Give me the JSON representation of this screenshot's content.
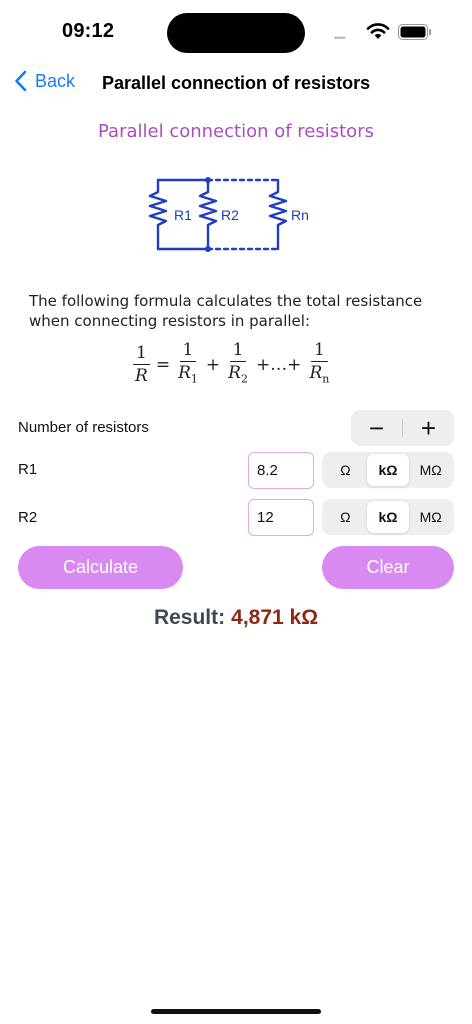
{
  "status_bar": {
    "time": "09:12",
    "signal": "•••••"
  },
  "nav": {
    "back_label": "Back",
    "title": "Parallel connection of resistors"
  },
  "heading": "Parallel connection of resistors",
  "circuit_labels": {
    "r1": "R1",
    "r2": "R2",
    "rn": "Rn"
  },
  "description": "The following formula calculates the total resistance when connecting resistors in parallel:",
  "formula": {
    "one": "1",
    "lhs_den": "R",
    "eq": "=",
    "plus": "+",
    "ellipsis": "+…+",
    "r_symbol": "R",
    "sub1": "1",
    "sub2": "2",
    "subn": "n"
  },
  "count_row": {
    "label": "Number of resistors",
    "minus": "−",
    "plus": "+"
  },
  "resistors": [
    {
      "label": "R1",
      "value": "8.2",
      "units": [
        "Ω",
        "kΩ",
        "MΩ"
      ],
      "selected_unit": "kΩ"
    },
    {
      "label": "R2",
      "value": "12",
      "units": [
        "Ω",
        "kΩ",
        "MΩ"
      ],
      "selected_unit": "kΩ"
    }
  ],
  "buttons": {
    "calculate": "Calculate",
    "clear": "Clear"
  },
  "result": {
    "label": "Result:",
    "value": "4,871 kΩ"
  },
  "colors": {
    "accent": "#1a7cf0",
    "heading": "#a94fbd",
    "button": "#d98af0",
    "result_value": "#8a2a14",
    "circuit": "#1f3fbf"
  }
}
